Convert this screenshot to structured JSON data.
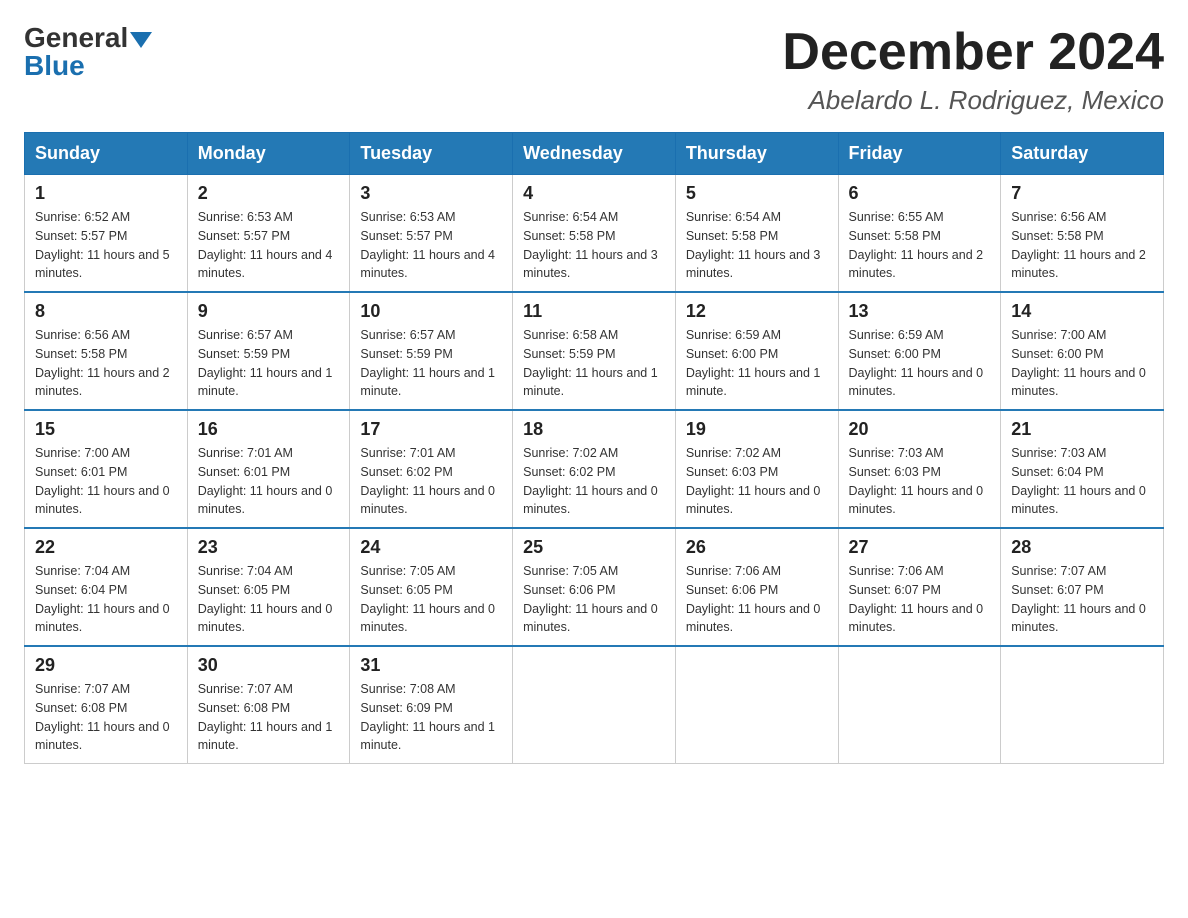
{
  "header": {
    "logo_general": "General",
    "logo_blue": "Blue",
    "month_title": "December 2024",
    "location": "Abelardo L. Rodriguez, Mexico"
  },
  "weekdays": [
    "Sunday",
    "Monday",
    "Tuesday",
    "Wednesday",
    "Thursday",
    "Friday",
    "Saturday"
  ],
  "weeks": [
    [
      {
        "day": "1",
        "sunrise": "6:52 AM",
        "sunset": "5:57 PM",
        "daylight": "11 hours and 5 minutes."
      },
      {
        "day": "2",
        "sunrise": "6:53 AM",
        "sunset": "5:57 PM",
        "daylight": "11 hours and 4 minutes."
      },
      {
        "day": "3",
        "sunrise": "6:53 AM",
        "sunset": "5:57 PM",
        "daylight": "11 hours and 4 minutes."
      },
      {
        "day": "4",
        "sunrise": "6:54 AM",
        "sunset": "5:58 PM",
        "daylight": "11 hours and 3 minutes."
      },
      {
        "day": "5",
        "sunrise": "6:54 AM",
        "sunset": "5:58 PM",
        "daylight": "11 hours and 3 minutes."
      },
      {
        "day": "6",
        "sunrise": "6:55 AM",
        "sunset": "5:58 PM",
        "daylight": "11 hours and 2 minutes."
      },
      {
        "day": "7",
        "sunrise": "6:56 AM",
        "sunset": "5:58 PM",
        "daylight": "11 hours and 2 minutes."
      }
    ],
    [
      {
        "day": "8",
        "sunrise": "6:56 AM",
        "sunset": "5:58 PM",
        "daylight": "11 hours and 2 minutes."
      },
      {
        "day": "9",
        "sunrise": "6:57 AM",
        "sunset": "5:59 PM",
        "daylight": "11 hours and 1 minute."
      },
      {
        "day": "10",
        "sunrise": "6:57 AM",
        "sunset": "5:59 PM",
        "daylight": "11 hours and 1 minute."
      },
      {
        "day": "11",
        "sunrise": "6:58 AM",
        "sunset": "5:59 PM",
        "daylight": "11 hours and 1 minute."
      },
      {
        "day": "12",
        "sunrise": "6:59 AM",
        "sunset": "6:00 PM",
        "daylight": "11 hours and 1 minute."
      },
      {
        "day": "13",
        "sunrise": "6:59 AM",
        "sunset": "6:00 PM",
        "daylight": "11 hours and 0 minutes."
      },
      {
        "day": "14",
        "sunrise": "7:00 AM",
        "sunset": "6:00 PM",
        "daylight": "11 hours and 0 minutes."
      }
    ],
    [
      {
        "day": "15",
        "sunrise": "7:00 AM",
        "sunset": "6:01 PM",
        "daylight": "11 hours and 0 minutes."
      },
      {
        "day": "16",
        "sunrise": "7:01 AM",
        "sunset": "6:01 PM",
        "daylight": "11 hours and 0 minutes."
      },
      {
        "day": "17",
        "sunrise": "7:01 AM",
        "sunset": "6:02 PM",
        "daylight": "11 hours and 0 minutes."
      },
      {
        "day": "18",
        "sunrise": "7:02 AM",
        "sunset": "6:02 PM",
        "daylight": "11 hours and 0 minutes."
      },
      {
        "day": "19",
        "sunrise": "7:02 AM",
        "sunset": "6:03 PM",
        "daylight": "11 hours and 0 minutes."
      },
      {
        "day": "20",
        "sunrise": "7:03 AM",
        "sunset": "6:03 PM",
        "daylight": "11 hours and 0 minutes."
      },
      {
        "day": "21",
        "sunrise": "7:03 AM",
        "sunset": "6:04 PM",
        "daylight": "11 hours and 0 minutes."
      }
    ],
    [
      {
        "day": "22",
        "sunrise": "7:04 AM",
        "sunset": "6:04 PM",
        "daylight": "11 hours and 0 minutes."
      },
      {
        "day": "23",
        "sunrise": "7:04 AM",
        "sunset": "6:05 PM",
        "daylight": "11 hours and 0 minutes."
      },
      {
        "day": "24",
        "sunrise": "7:05 AM",
        "sunset": "6:05 PM",
        "daylight": "11 hours and 0 minutes."
      },
      {
        "day": "25",
        "sunrise": "7:05 AM",
        "sunset": "6:06 PM",
        "daylight": "11 hours and 0 minutes."
      },
      {
        "day": "26",
        "sunrise": "7:06 AM",
        "sunset": "6:06 PM",
        "daylight": "11 hours and 0 minutes."
      },
      {
        "day": "27",
        "sunrise": "7:06 AM",
        "sunset": "6:07 PM",
        "daylight": "11 hours and 0 minutes."
      },
      {
        "day": "28",
        "sunrise": "7:07 AM",
        "sunset": "6:07 PM",
        "daylight": "11 hours and 0 minutes."
      }
    ],
    [
      {
        "day": "29",
        "sunrise": "7:07 AM",
        "sunset": "6:08 PM",
        "daylight": "11 hours and 0 minutes."
      },
      {
        "day": "30",
        "sunrise": "7:07 AM",
        "sunset": "6:08 PM",
        "daylight": "11 hours and 1 minute."
      },
      {
        "day": "31",
        "sunrise": "7:08 AM",
        "sunset": "6:09 PM",
        "daylight": "11 hours and 1 minute."
      },
      null,
      null,
      null,
      null
    ]
  ]
}
